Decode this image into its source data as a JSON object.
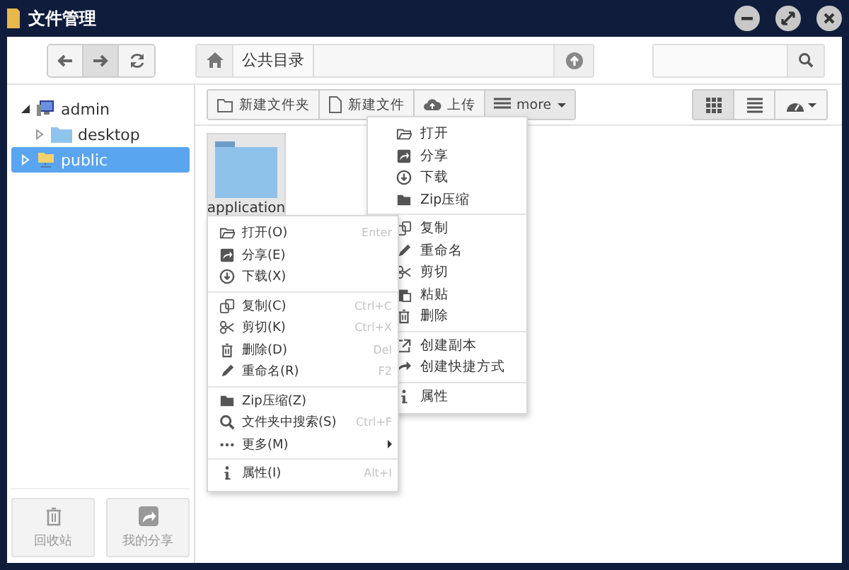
{
  "window": {
    "title": "文件管理"
  },
  "breadcrumb": [
    "公共目录"
  ],
  "toolbar": [
    {
      "label": "新建文件夹",
      "kind": "button"
    },
    {
      "label": "新建文件",
      "kind": "button"
    },
    {
      "label": "上传",
      "kind": "button"
    },
    {
      "label": "more",
      "kind": "dropdown"
    }
  ],
  "views": [
    {
      "selected": true
    },
    {
      "selected": false
    },
    {
      "selected": false
    }
  ],
  "tree": [
    {
      "label": "admin",
      "expanded": true,
      "selected": false,
      "children": [
        {
          "label": "desktop",
          "expanded": false,
          "selected": false
        }
      ]
    },
    {
      "label": "public",
      "expanded": false,
      "selected": true
    }
  ],
  "files": [
    {
      "name": "application",
      "selected": true
    }
  ],
  "sidebar_buttons": [
    "回收站",
    "我的分享"
  ],
  "more_menu": [
    [
      {
        "label": "打开"
      },
      {
        "label": "分享"
      },
      {
        "label": "下载"
      },
      {
        "label": "Zip压缩"
      }
    ],
    [
      {
        "label": "复制"
      },
      {
        "label": "重命名"
      },
      {
        "label": "剪切"
      },
      {
        "label": "粘贴"
      },
      {
        "label": "删除"
      }
    ],
    [
      {
        "label": "创建副本"
      },
      {
        "label": "创建快捷方式"
      }
    ],
    [
      {
        "label": "属性"
      }
    ]
  ],
  "context_menu": [
    [
      {
        "label": "打开(O)",
        "shortcut": "Enter"
      },
      {
        "label": "分享(E)"
      },
      {
        "label": "下载(X)"
      }
    ],
    [
      {
        "label": "复制(C)",
        "shortcut": "Ctrl+C"
      },
      {
        "label": "剪切(K)",
        "shortcut": "Ctrl+X"
      },
      {
        "label": "删除(D)",
        "shortcut": "Del"
      },
      {
        "label": "重命名(R)",
        "shortcut": "F2"
      }
    ],
    [
      {
        "label": "Zip压缩(Z)"
      },
      {
        "label": "文件夹中搜索(S)",
        "shortcut": "Ctrl+F"
      },
      {
        "label": "更多(M)",
        "submenu": true
      }
    ],
    [
      {
        "label": "属性(I)",
        "shortcut": "Alt+I"
      }
    ]
  ]
}
